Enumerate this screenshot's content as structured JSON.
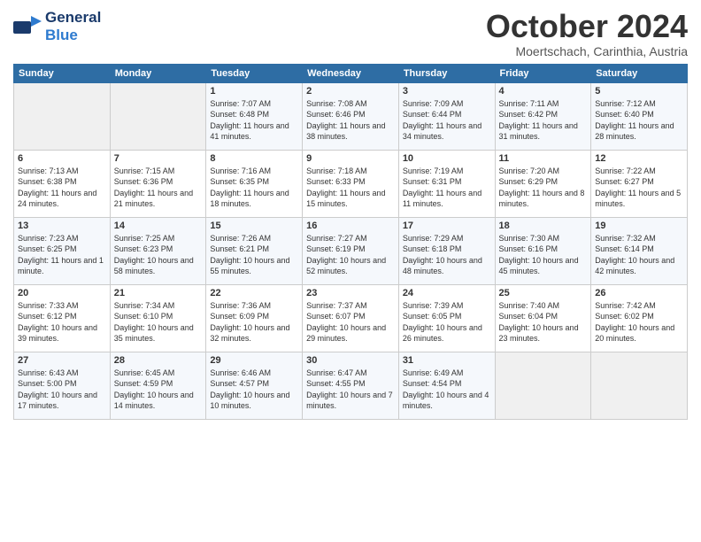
{
  "header": {
    "logo_general": "General",
    "logo_blue": "Blue",
    "month_title": "October 2024",
    "location": "Moertschach, Carinthia, Austria"
  },
  "days_of_week": [
    "Sunday",
    "Monday",
    "Tuesday",
    "Wednesday",
    "Thursday",
    "Friday",
    "Saturday"
  ],
  "weeks": [
    [
      {
        "day": "",
        "sunrise": "",
        "sunset": "",
        "daylight": "",
        "empty": true
      },
      {
        "day": "",
        "sunrise": "",
        "sunset": "",
        "daylight": "",
        "empty": true
      },
      {
        "day": "1",
        "sunrise": "Sunrise: 7:07 AM",
        "sunset": "Sunset: 6:48 PM",
        "daylight": "Daylight: 11 hours and 41 minutes."
      },
      {
        "day": "2",
        "sunrise": "Sunrise: 7:08 AM",
        "sunset": "Sunset: 6:46 PM",
        "daylight": "Daylight: 11 hours and 38 minutes."
      },
      {
        "day": "3",
        "sunrise": "Sunrise: 7:09 AM",
        "sunset": "Sunset: 6:44 PM",
        "daylight": "Daylight: 11 hours and 34 minutes."
      },
      {
        "day": "4",
        "sunrise": "Sunrise: 7:11 AM",
        "sunset": "Sunset: 6:42 PM",
        "daylight": "Daylight: 11 hours and 31 minutes."
      },
      {
        "day": "5",
        "sunrise": "Sunrise: 7:12 AM",
        "sunset": "Sunset: 6:40 PM",
        "daylight": "Daylight: 11 hours and 28 minutes."
      }
    ],
    [
      {
        "day": "6",
        "sunrise": "Sunrise: 7:13 AM",
        "sunset": "Sunset: 6:38 PM",
        "daylight": "Daylight: 11 hours and 24 minutes."
      },
      {
        "day": "7",
        "sunrise": "Sunrise: 7:15 AM",
        "sunset": "Sunset: 6:36 PM",
        "daylight": "Daylight: 11 hours and 21 minutes."
      },
      {
        "day": "8",
        "sunrise": "Sunrise: 7:16 AM",
        "sunset": "Sunset: 6:35 PM",
        "daylight": "Daylight: 11 hours and 18 minutes."
      },
      {
        "day": "9",
        "sunrise": "Sunrise: 7:18 AM",
        "sunset": "Sunset: 6:33 PM",
        "daylight": "Daylight: 11 hours and 15 minutes."
      },
      {
        "day": "10",
        "sunrise": "Sunrise: 7:19 AM",
        "sunset": "Sunset: 6:31 PM",
        "daylight": "Daylight: 11 hours and 11 minutes."
      },
      {
        "day": "11",
        "sunrise": "Sunrise: 7:20 AM",
        "sunset": "Sunset: 6:29 PM",
        "daylight": "Daylight: 11 hours and 8 minutes."
      },
      {
        "day": "12",
        "sunrise": "Sunrise: 7:22 AM",
        "sunset": "Sunset: 6:27 PM",
        "daylight": "Daylight: 11 hours and 5 minutes."
      }
    ],
    [
      {
        "day": "13",
        "sunrise": "Sunrise: 7:23 AM",
        "sunset": "Sunset: 6:25 PM",
        "daylight": "Daylight: 11 hours and 1 minute."
      },
      {
        "day": "14",
        "sunrise": "Sunrise: 7:25 AM",
        "sunset": "Sunset: 6:23 PM",
        "daylight": "Daylight: 10 hours and 58 minutes."
      },
      {
        "day": "15",
        "sunrise": "Sunrise: 7:26 AM",
        "sunset": "Sunset: 6:21 PM",
        "daylight": "Daylight: 10 hours and 55 minutes."
      },
      {
        "day": "16",
        "sunrise": "Sunrise: 7:27 AM",
        "sunset": "Sunset: 6:19 PM",
        "daylight": "Daylight: 10 hours and 52 minutes."
      },
      {
        "day": "17",
        "sunrise": "Sunrise: 7:29 AM",
        "sunset": "Sunset: 6:18 PM",
        "daylight": "Daylight: 10 hours and 48 minutes."
      },
      {
        "day": "18",
        "sunrise": "Sunrise: 7:30 AM",
        "sunset": "Sunset: 6:16 PM",
        "daylight": "Daylight: 10 hours and 45 minutes."
      },
      {
        "day": "19",
        "sunrise": "Sunrise: 7:32 AM",
        "sunset": "Sunset: 6:14 PM",
        "daylight": "Daylight: 10 hours and 42 minutes."
      }
    ],
    [
      {
        "day": "20",
        "sunrise": "Sunrise: 7:33 AM",
        "sunset": "Sunset: 6:12 PM",
        "daylight": "Daylight: 10 hours and 39 minutes."
      },
      {
        "day": "21",
        "sunrise": "Sunrise: 7:34 AM",
        "sunset": "Sunset: 6:10 PM",
        "daylight": "Daylight: 10 hours and 35 minutes."
      },
      {
        "day": "22",
        "sunrise": "Sunrise: 7:36 AM",
        "sunset": "Sunset: 6:09 PM",
        "daylight": "Daylight: 10 hours and 32 minutes."
      },
      {
        "day": "23",
        "sunrise": "Sunrise: 7:37 AM",
        "sunset": "Sunset: 6:07 PM",
        "daylight": "Daylight: 10 hours and 29 minutes."
      },
      {
        "day": "24",
        "sunrise": "Sunrise: 7:39 AM",
        "sunset": "Sunset: 6:05 PM",
        "daylight": "Daylight: 10 hours and 26 minutes."
      },
      {
        "day": "25",
        "sunrise": "Sunrise: 7:40 AM",
        "sunset": "Sunset: 6:04 PM",
        "daylight": "Daylight: 10 hours and 23 minutes."
      },
      {
        "day": "26",
        "sunrise": "Sunrise: 7:42 AM",
        "sunset": "Sunset: 6:02 PM",
        "daylight": "Daylight: 10 hours and 20 minutes."
      }
    ],
    [
      {
        "day": "27",
        "sunrise": "Sunrise: 6:43 AM",
        "sunset": "Sunset: 5:00 PM",
        "daylight": "Daylight: 10 hours and 17 minutes."
      },
      {
        "day": "28",
        "sunrise": "Sunrise: 6:45 AM",
        "sunset": "Sunset: 4:59 PM",
        "daylight": "Daylight: 10 hours and 14 minutes."
      },
      {
        "day": "29",
        "sunrise": "Sunrise: 6:46 AM",
        "sunset": "Sunset: 4:57 PM",
        "daylight": "Daylight: 10 hours and 10 minutes."
      },
      {
        "day": "30",
        "sunrise": "Sunrise: 6:47 AM",
        "sunset": "Sunset: 4:55 PM",
        "daylight": "Daylight: 10 hours and 7 minutes."
      },
      {
        "day": "31",
        "sunrise": "Sunrise: 6:49 AM",
        "sunset": "Sunset: 4:54 PM",
        "daylight": "Daylight: 10 hours and 4 minutes."
      },
      {
        "day": "",
        "sunrise": "",
        "sunset": "",
        "daylight": "",
        "empty": true
      },
      {
        "day": "",
        "sunrise": "",
        "sunset": "",
        "daylight": "",
        "empty": true
      }
    ]
  ]
}
